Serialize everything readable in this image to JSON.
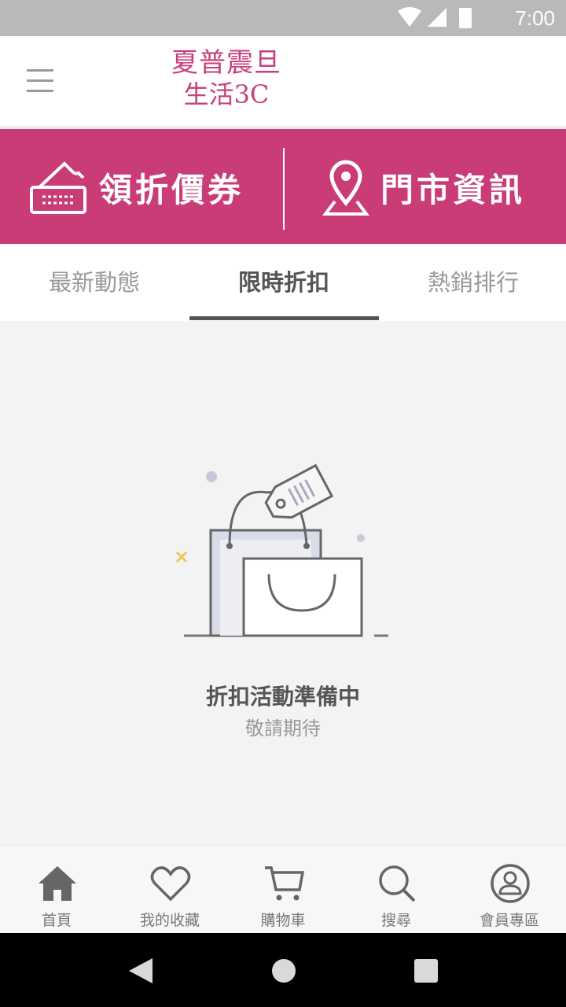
{
  "status": {
    "time": "7:00"
  },
  "header": {
    "logo_line1": "夏普震旦",
    "logo_line2": "生活3C"
  },
  "banner": {
    "coupon_label": "領折價券",
    "store_label": "門市資訊"
  },
  "tabs": [
    {
      "label": "最新動態"
    },
    {
      "label": "限時折扣"
    },
    {
      "label": "熱銷排行"
    }
  ],
  "empty_state": {
    "title": "折扣活動準備中",
    "subtitle": "敬請期待"
  },
  "bottom_nav": [
    {
      "label": "首頁",
      "icon": "home-icon"
    },
    {
      "label": "我的收藏",
      "icon": "heart-icon"
    },
    {
      "label": "購物車",
      "icon": "cart-icon"
    },
    {
      "label": "搜尋",
      "icon": "search-icon"
    },
    {
      "label": "會員專區",
      "icon": "user-icon"
    }
  ],
  "colors": {
    "brand": "#c93c77",
    "accent_text": "#555555",
    "muted_text": "#999999"
  }
}
